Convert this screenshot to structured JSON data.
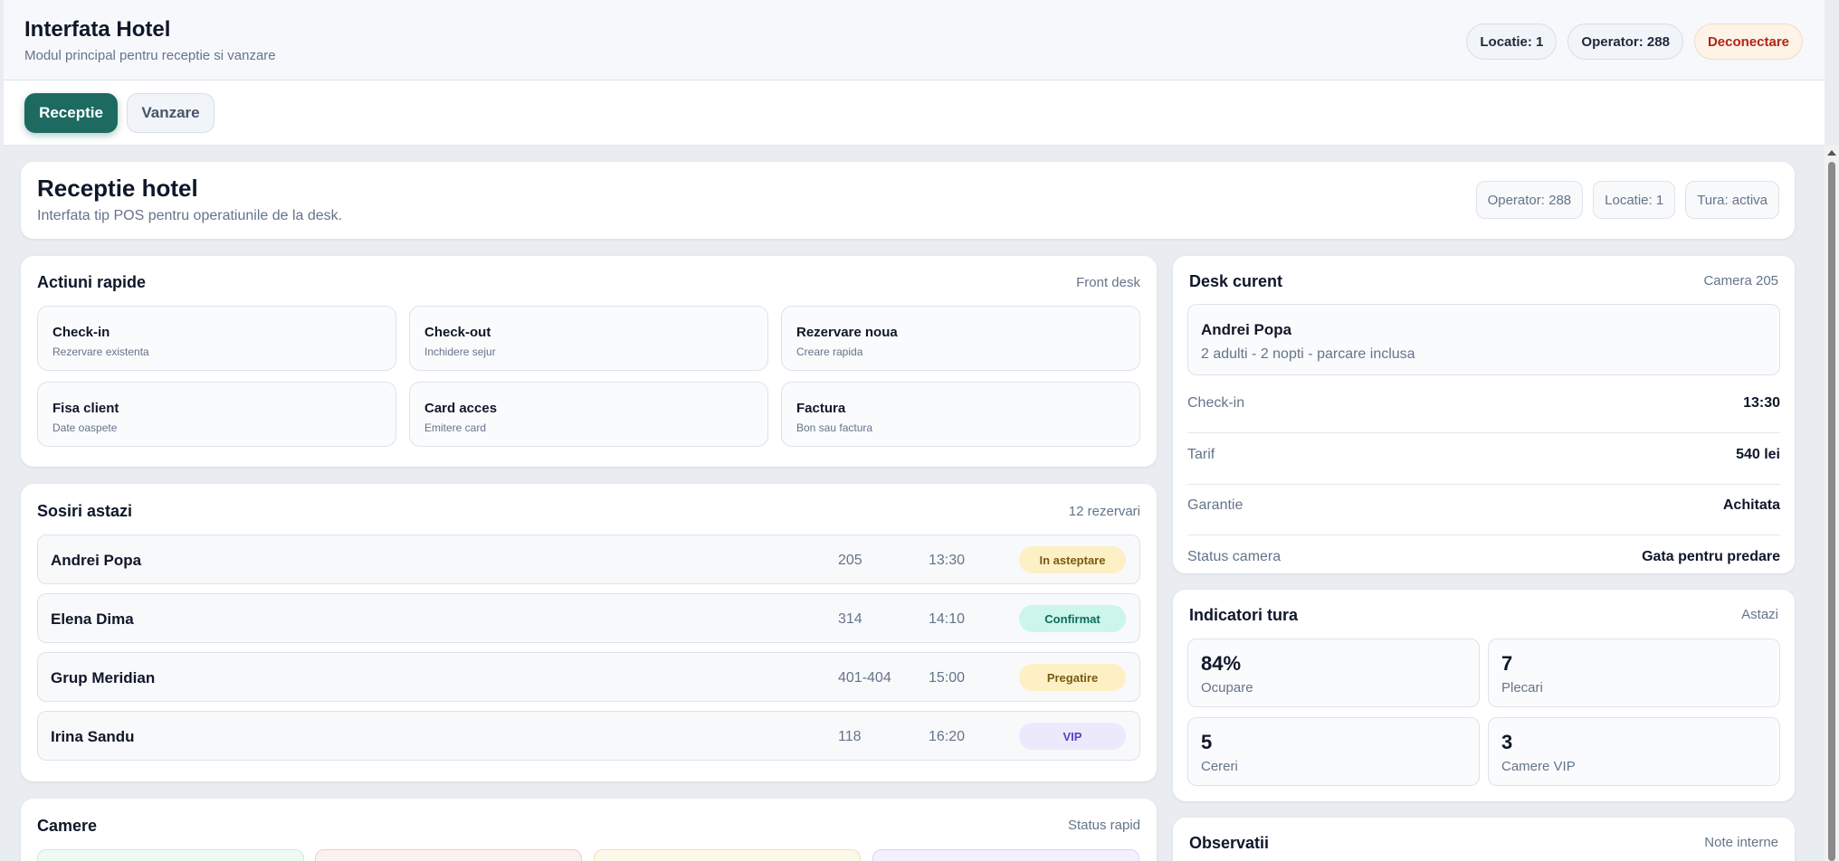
{
  "header": {
    "title": "Interfata Hotel",
    "subtitle": "Modul principal pentru receptie si vanzare",
    "location": "Locatie: 1",
    "operator": "Operator: 288",
    "logout": "Deconectare"
  },
  "tabs": [
    {
      "label": "Receptie",
      "active": true
    },
    {
      "label": "Vanzare",
      "active": false
    }
  ],
  "page": {
    "title": "Receptie hotel",
    "subtitle": "Interfata tip POS pentru operatiunile de la desk.",
    "chips": [
      "Operator: 288",
      "Locatie: 1",
      "Tura: activa"
    ]
  },
  "quick_actions": {
    "title": "Actiuni rapide",
    "meta": "Front desk",
    "items": [
      {
        "title": "Check-in",
        "sub": "Rezervare existenta"
      },
      {
        "title": "Check-out",
        "sub": "Inchidere sejur"
      },
      {
        "title": "Rezervare noua",
        "sub": "Creare rapida"
      },
      {
        "title": "Fisa client",
        "sub": "Date oaspete"
      },
      {
        "title": "Card acces",
        "sub": "Emitere card"
      },
      {
        "title": "Factura",
        "sub": "Bon sau factura"
      }
    ]
  },
  "arrivals": {
    "title": "Sosiri astazi",
    "meta": "12 rezervari",
    "rows": [
      {
        "name": "Andrei Popa",
        "room": "205",
        "time": "13:30",
        "status": "In asteptare"
      },
      {
        "name": "Elena Dima",
        "room": "314",
        "time": "14:10",
        "status": "Confirmat"
      },
      {
        "name": "Grup Meridian",
        "room": "401-404",
        "time": "15:00",
        "status": "Pregatire"
      },
      {
        "name": "Irina Sandu",
        "room": "118",
        "time": "16:20",
        "status": "VIP"
      }
    ]
  },
  "rooms": {
    "title": "Camere",
    "meta": "Status rapid",
    "tile_colors": [
      "#eefaf2",
      "#fdf0f0",
      "#fdf8ea",
      "#f2f1fd"
    ]
  },
  "desk": {
    "title": "Desk curent",
    "meta": "Camera 205",
    "guest_name": "Andrei Popa",
    "guest_info": "2 adulti - 2 nopti - parcare inclusa",
    "details": [
      {
        "key": "Check-in",
        "value": "13:30"
      },
      {
        "key": "Tarif",
        "value": "540 lei"
      },
      {
        "key": "Garantie",
        "value": "Achitata"
      },
      {
        "key": "Status camera",
        "value": "Gata pentru predare"
      }
    ]
  },
  "indicators": {
    "title": "Indicatori tura",
    "meta": "Astazi",
    "stats": [
      {
        "value": "84%",
        "label": "Ocupare"
      },
      {
        "value": "7",
        "label": "Plecari"
      },
      {
        "value": "5",
        "label": "Cereri"
      },
      {
        "value": "3",
        "label": "Camere VIP"
      }
    ]
  },
  "notes": {
    "title": "Observatii",
    "meta": "Note interne"
  }
}
